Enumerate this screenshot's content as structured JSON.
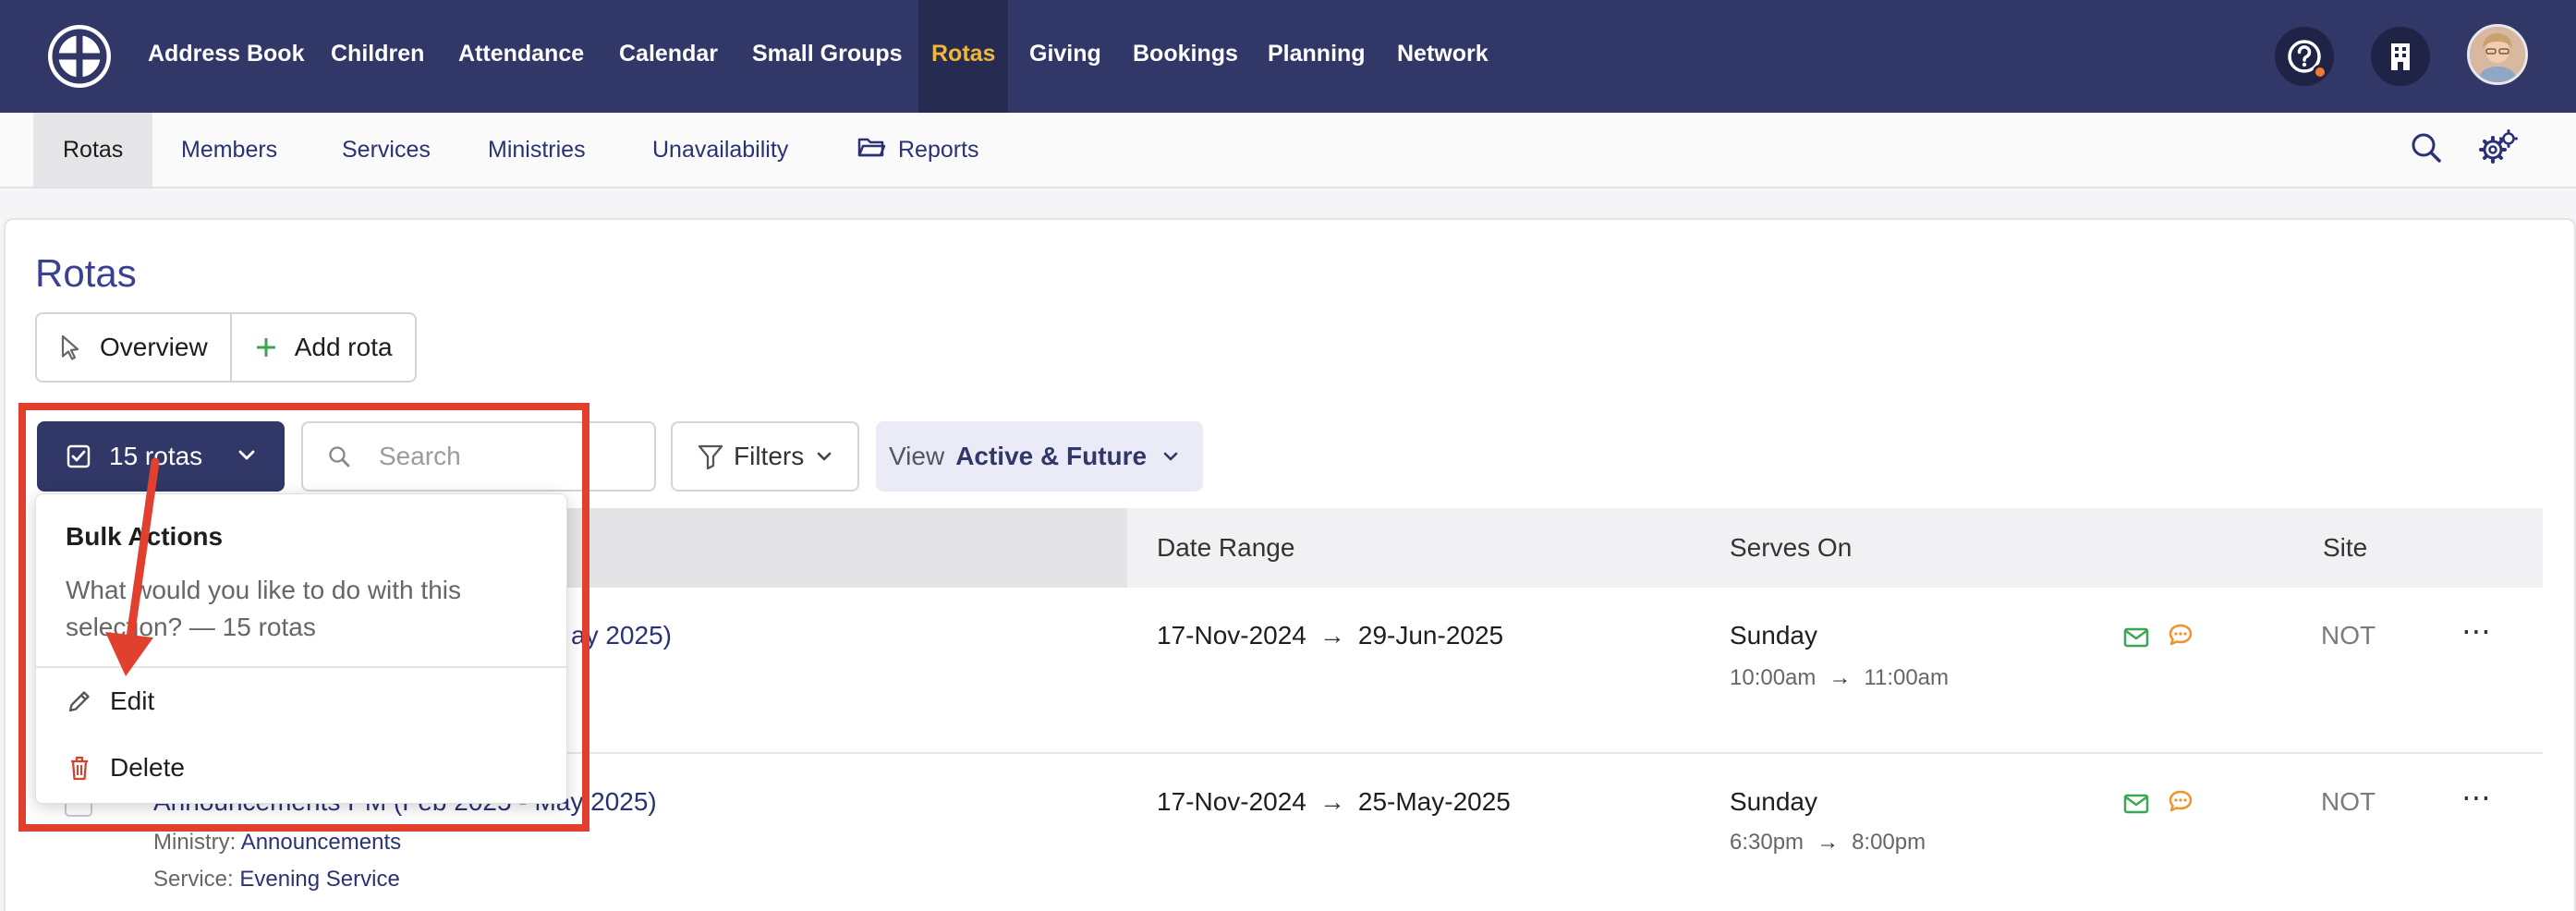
{
  "topnav": {
    "items": [
      "Address Book",
      "Children",
      "Attendance",
      "Calendar",
      "Small Groups",
      "Rotas",
      "Giving",
      "Bookings",
      "Planning",
      "Network"
    ],
    "active": "Rotas",
    "help_icon": "help-circle-icon",
    "building_icon": "building-icon"
  },
  "subnav": {
    "tabs": [
      "Rotas",
      "Members",
      "Services",
      "Ministries",
      "Unavailability",
      "Reports"
    ],
    "active": "Rotas"
  },
  "page": {
    "title": "Rotas",
    "overview_label": "Overview",
    "add_label": "Add rota"
  },
  "toolbar": {
    "selection_label": "15 rotas",
    "search_placeholder": "Search",
    "filters_label": "Filters",
    "view_label": "View",
    "view_value": "Active & Future"
  },
  "table": {
    "headers": [
      "Date Range",
      "Serves On",
      "Site"
    ],
    "rows": [
      {
        "name_suffix": "ay 2025)",
        "start": "17-Nov-2024",
        "end": "29-Jun-2025",
        "day": "Sunday",
        "time_start": "10:00am",
        "time_end": "11:00am",
        "site": "NOT"
      },
      {
        "name": "Announcements PM (Feb 2025 - May 2025)",
        "ministry_label": "Ministry:",
        "ministry": "Announcements",
        "service_label": "Service:",
        "service": "Evening Service",
        "start": "17-Nov-2024",
        "end": "25-May-2025",
        "day": "Sunday",
        "time_start": "6:30pm",
        "time_end": "8:00pm",
        "site": "NOT"
      }
    ]
  },
  "bulk": {
    "title": "Bulk Actions",
    "description": "What would you like to do with this selection? — 15 rotas",
    "edit": "Edit",
    "delete": "Delete"
  },
  "colors": {
    "nav_bg": "#313766",
    "active_nav": "#f2b636",
    "link": "#2a3275",
    "annotation": "#e2402f",
    "email_icon": "#3aa655",
    "sms_icon": "#f0932b"
  }
}
